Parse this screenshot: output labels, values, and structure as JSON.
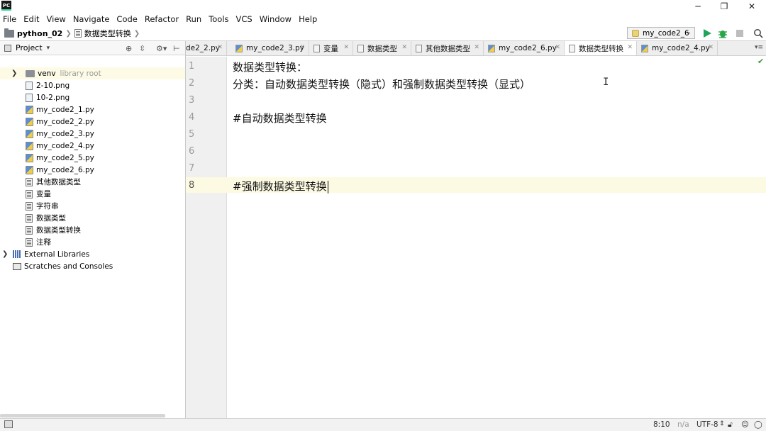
{
  "window": {
    "logo_text": "PC",
    "minimize": "─",
    "restore": "❐",
    "close": "✕"
  },
  "menu": [
    "File",
    "Edit",
    "View",
    "Navigate",
    "Code",
    "Refactor",
    "Run",
    "Tools",
    "VCS",
    "Window",
    "Help"
  ],
  "breadcrumb": {
    "project": "python_02",
    "file": "数据类型转换"
  },
  "run_config": {
    "name": "my_code2_6",
    "colors": {
      "run": "#22a35a",
      "debug": "#2aa64a",
      "stop": "#bdbdbd"
    }
  },
  "project_panel": {
    "title": "Project",
    "items": [
      {
        "label": "venv",
        "extra": "library root",
        "type": "folder",
        "expandable": true
      },
      {
        "label": "2-10.png",
        "type": "png"
      },
      {
        "label": "10-2.png",
        "type": "png"
      },
      {
        "label": "my_code2_1.py",
        "type": "py"
      },
      {
        "label": "my_code2_2.py",
        "type": "py"
      },
      {
        "label": "my_code2_3.py",
        "type": "py"
      },
      {
        "label": "my_code2_4.py",
        "type": "py"
      },
      {
        "label": "my_code2_5.py",
        "type": "py"
      },
      {
        "label": "my_code2_6.py",
        "type": "py"
      },
      {
        "label": "其他数据类型",
        "type": "txt"
      },
      {
        "label": "变量",
        "type": "txt"
      },
      {
        "label": "字符串",
        "type": "txt"
      },
      {
        "label": "数据类型",
        "type": "txt"
      },
      {
        "label": "数据类型转换",
        "type": "txt"
      },
      {
        "label": "注释",
        "type": "txt"
      }
    ],
    "external_libraries": "External Libraries",
    "scratches": "Scratches and Consoles"
  },
  "tabs": [
    {
      "label": "de2_2.py",
      "type": "py"
    },
    {
      "label": "my_code2_3.py",
      "type": "py"
    },
    {
      "label": "变量",
      "type": "txt"
    },
    {
      "label": "数据类型",
      "type": "txt"
    },
    {
      "label": "其他数据类型",
      "type": "txt"
    },
    {
      "label": "my_code2_6.py",
      "type": "py"
    },
    {
      "label": "数据类型转换",
      "type": "txt",
      "active": true
    },
    {
      "label": "my_code2_4.py",
      "type": "py"
    }
  ],
  "editor": {
    "line_numbers": [
      "1",
      "2",
      "3",
      "4",
      "5",
      "6",
      "7",
      "8"
    ],
    "lines": [
      "数据类型转换：",
      "分类：自动数据类型转换（隐式）和强制数据类型转换（显式）",
      "",
      "#自动数据类型转换",
      "",
      "",
      "",
      "#强制数据类型转换"
    ]
  },
  "status": {
    "position": "8:10",
    "na": "n/a",
    "encoding": "UTF-8"
  }
}
